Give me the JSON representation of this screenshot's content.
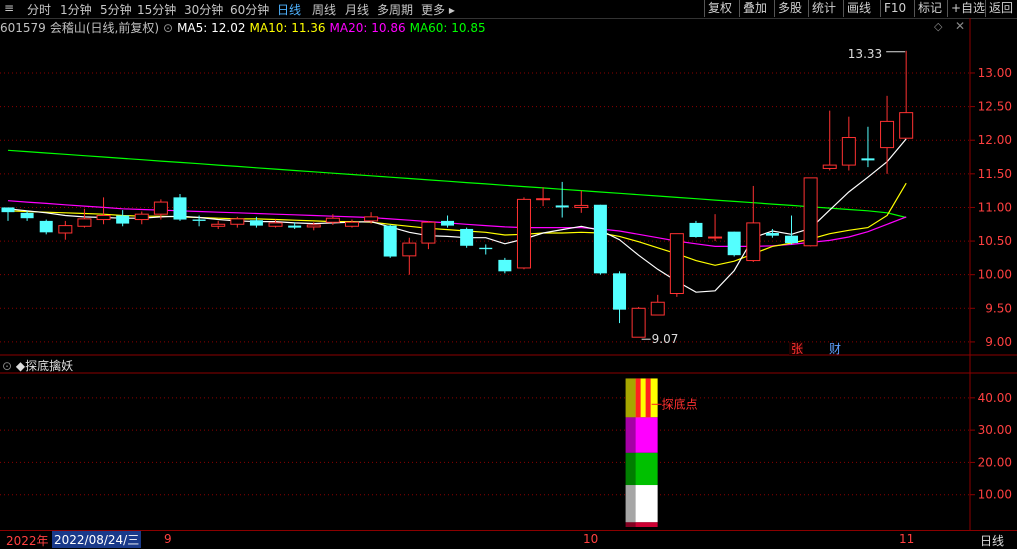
{
  "toolbar": {
    "timeframes": [
      "分时",
      "1分钟",
      "5分钟",
      "15分钟",
      "30分钟",
      "60分钟",
      "日线",
      "周线",
      "月线",
      "多周期",
      "更多"
    ],
    "active_index": 6,
    "right_buttons": [
      "复权",
      "叠加",
      "多股",
      "统计",
      "画线",
      "F10",
      "标记",
      "+自选",
      "返回"
    ]
  },
  "info": {
    "code": "601579",
    "name": "会稽山",
    "mode": "(日线,前复权)",
    "ma5": "MA5: 12.02",
    "ma10": "MA10: 11.36",
    "ma20": "MA20: 10.86",
    "ma60": "MA60: 10.85"
  },
  "colors": {
    "up": "#ff3232",
    "down": "#54ffff",
    "ma5": "#ffffff",
    "ma10": "#ffff00",
    "ma20": "#ff00ff",
    "ma60": "#00ff00",
    "grid": "#8b0000",
    "axis_text": "#ff4040"
  },
  "main_axis": {
    "ticks": [
      "13.00",
      "12.50",
      "12.00",
      "11.50",
      "11.00",
      "10.50",
      "10.00",
      "9.50",
      "9.00"
    ],
    "high_label": "13.33",
    "low_label": "9.07",
    "markers": [
      "张",
      "财"
    ]
  },
  "indicator": {
    "title": "◆探底擒妖",
    "ticks": [
      "40.00",
      "30.00",
      "20.00",
      "10.00"
    ],
    "signal_label": "探底点"
  },
  "bottom": {
    "year": "2022年",
    "cursor_date": "2022/08/24/三",
    "month_labels": [
      "9",
      "10",
      "11"
    ],
    "period": "日线"
  },
  "chart_data": {
    "type": "candlestick",
    "ylim": [
      8.85,
      13.55
    ],
    "candles": [
      [
        11.0,
        10.93,
        11.0,
        10.8
      ],
      [
        10.92,
        10.84,
        10.95,
        10.8
      ],
      [
        10.8,
        10.63,
        10.82,
        10.6
      ],
      [
        10.62,
        10.73,
        10.8,
        10.52
      ],
      [
        10.72,
        10.83,
        10.98,
        10.7
      ],
      [
        10.82,
        10.88,
        11.15,
        10.75
      ],
      [
        10.88,
        10.76,
        10.96,
        10.72
      ],
      [
        10.82,
        10.9,
        10.94,
        10.75
      ],
      [
        10.9,
        11.08,
        11.12,
        10.82
      ],
      [
        11.15,
        10.82,
        11.2,
        10.8
      ],
      [
        10.82,
        10.8,
        10.88,
        10.72
      ],
      [
        10.72,
        10.75,
        10.8,
        10.68
      ],
      [
        10.75,
        10.83,
        10.86,
        10.7
      ],
      [
        10.81,
        10.73,
        10.86,
        10.7
      ],
      [
        10.72,
        10.77,
        10.82,
        10.7
      ],
      [
        10.73,
        10.7,
        10.78,
        10.68
      ],
      [
        10.71,
        10.74,
        10.78,
        10.66
      ],
      [
        10.78,
        10.84,
        10.9,
        10.74
      ],
      [
        10.72,
        10.78,
        10.82,
        10.7
      ],
      [
        10.8,
        10.86,
        10.93,
        10.76
      ],
      [
        10.73,
        10.27,
        10.74,
        10.25
      ],
      [
        10.28,
        10.47,
        10.55,
        10.0
      ],
      [
        10.47,
        10.78,
        10.8,
        10.38
      ],
      [
        10.8,
        10.73,
        10.88,
        10.7
      ],
      [
        10.68,
        10.43,
        10.7,
        10.4
      ],
      [
        10.4,
        10.38,
        10.45,
        10.3
      ],
      [
        10.22,
        10.05,
        10.25,
        10.02
      ],
      [
        10.1,
        11.12,
        11.15,
        10.08
      ],
      [
        11.12,
        11.13,
        11.3,
        11.02
      ],
      [
        11.03,
        11.0,
        11.38,
        10.85
      ],
      [
        11.0,
        11.03,
        11.25,
        10.92
      ],
      [
        11.04,
        10.02,
        11.04,
        10.0
      ],
      [
        10.02,
        9.48,
        10.05,
        9.28
      ],
      [
        9.07,
        9.5,
        9.52,
        9.07
      ],
      [
        9.4,
        9.59,
        9.7,
        9.4
      ],
      [
        9.72,
        10.61,
        10.61,
        9.67
      ],
      [
        10.77,
        10.56,
        10.8,
        10.55
      ],
      [
        10.56,
        10.56,
        10.9,
        10.5
      ],
      [
        10.64,
        10.29,
        10.64,
        10.27
      ],
      [
        10.21,
        10.77,
        11.32,
        10.19
      ],
      [
        10.62,
        10.58,
        10.68,
        10.55
      ],
      [
        10.58,
        10.47,
        10.88,
        10.45
      ],
      [
        10.43,
        11.44,
        11.44,
        10.42
      ],
      [
        11.58,
        11.63,
        12.44,
        11.55
      ],
      [
        11.63,
        12.04,
        12.35,
        11.55
      ],
      [
        11.73,
        11.7,
        12.2,
        11.6
      ],
      [
        11.89,
        12.28,
        12.66,
        11.5
      ],
      [
        12.03,
        12.41,
        13.33,
        12.03
      ]
    ],
    "ma5": [
      10.98,
      10.95,
      10.92,
      10.88,
      10.86,
      10.85,
      10.84,
      10.84,
      10.86,
      10.87,
      10.85,
      10.82,
      10.8,
      10.79,
      10.79,
      10.77,
      10.76,
      10.77,
      10.78,
      10.79,
      10.71,
      10.63,
      10.58,
      10.57,
      10.55,
      10.55,
      10.46,
      10.53,
      10.62,
      10.67,
      10.72,
      10.66,
      10.52,
      10.29,
      10.08,
      9.9,
      9.74,
      9.76,
      10.06,
      10.55,
      10.65,
      10.6,
      10.69,
      10.96,
      11.23,
      11.45,
      11.68,
      12.02
    ],
    "ma10": [
      10.95,
      10.94,
      10.93,
      10.92,
      10.91,
      10.9,
      10.88,
      10.87,
      10.87,
      10.86,
      10.85,
      10.84,
      10.83,
      10.83,
      10.82,
      10.81,
      10.8,
      10.79,
      10.79,
      10.78,
      10.75,
      10.72,
      10.69,
      10.67,
      10.65,
      10.63,
      10.59,
      10.6,
      10.62,
      10.62,
      10.63,
      10.62,
      10.57,
      10.49,
      10.4,
      10.31,
      10.21,
      10.14,
      10.2,
      10.31,
      10.42,
      10.47,
      10.53,
      10.61,
      10.66,
      10.7,
      10.88,
      11.36
    ],
    "ma20": [
      11.1,
      11.08,
      11.06,
      11.04,
      11.02,
      11.0,
      10.98,
      10.97,
      10.96,
      10.95,
      10.94,
      10.93,
      10.92,
      10.91,
      10.9,
      10.89,
      10.88,
      10.87,
      10.86,
      10.85,
      10.83,
      10.81,
      10.79,
      10.77,
      10.75,
      10.73,
      10.71,
      10.7,
      10.7,
      10.7,
      10.7,
      10.68,
      10.65,
      10.6,
      10.55,
      10.5,
      10.46,
      10.42,
      10.42,
      10.42,
      10.43,
      10.45,
      10.48,
      10.51,
      10.56,
      10.64,
      10.75,
      10.86
    ],
    "ma60": [
      11.85,
      11.83,
      11.81,
      11.79,
      11.77,
      11.75,
      11.73,
      11.71,
      11.69,
      11.67,
      11.65,
      11.63,
      11.61,
      11.59,
      11.57,
      11.55,
      11.53,
      11.51,
      11.49,
      11.47,
      11.45,
      11.43,
      11.41,
      11.39,
      11.37,
      11.35,
      11.33,
      11.31,
      11.29,
      11.27,
      11.25,
      11.23,
      11.21,
      11.19,
      11.17,
      11.15,
      11.13,
      11.11,
      11.09,
      11.07,
      11.05,
      11.03,
      11.01,
      10.99,
      10.97,
      10.95,
      10.92,
      10.85
    ],
    "indicator_ylim": [
      0,
      48
    ],
    "signal_bar": {
      "index": 33,
      "segments": [
        {
          "from": 0,
          "to": 1.5,
          "color": "#cc0033"
        },
        {
          "from": 1.5,
          "to": 13,
          "color": "#ffffff"
        },
        {
          "from": 13,
          "to": 23,
          "color": "#00c000"
        },
        {
          "from": 23,
          "to": 34,
          "color": "#ff00ff"
        },
        {
          "from": 34,
          "to": 46,
          "color": "#ffff00"
        }
      ]
    }
  }
}
